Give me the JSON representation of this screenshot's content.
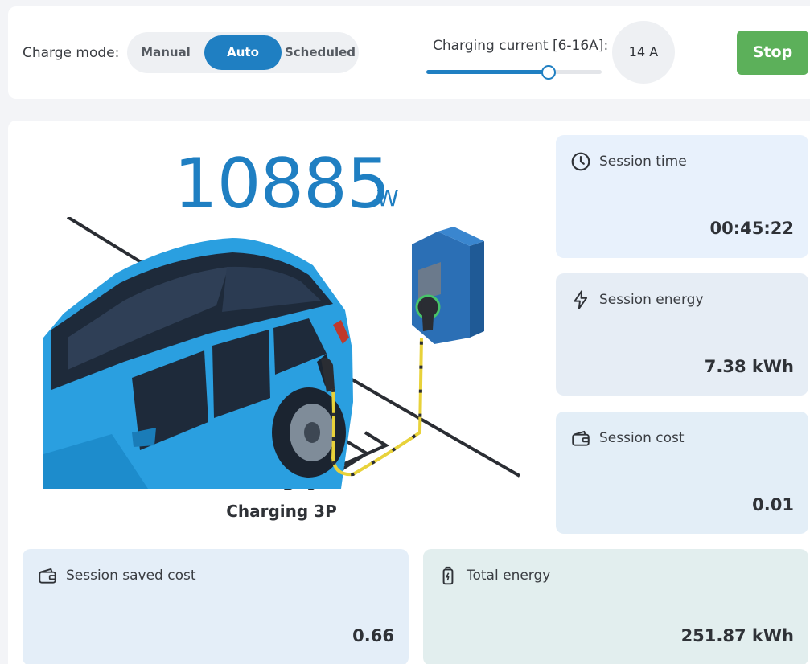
{
  "controls": {
    "charge_mode_label": "Charge mode:",
    "modes": [
      {
        "label": "Manual",
        "selected": false
      },
      {
        "label": "Auto",
        "selected": true
      },
      {
        "label": "Scheduled",
        "selected": false
      }
    ],
    "current_label": "Charging current [6-16A]:",
    "current_min": 6,
    "current_max": 16,
    "current_value": 14,
    "current_display": "14 A",
    "stop_label": "Stop"
  },
  "power": {
    "value": "10885",
    "unit": "W"
  },
  "status": "Charging 3P",
  "cards": {
    "session_time": {
      "label": "Session time",
      "value": "00:45:22"
    },
    "session_energy": {
      "label": "Session energy",
      "value": "7.38 kWh"
    },
    "session_cost": {
      "label": "Session cost",
      "value": "0.01"
    },
    "session_saved_cost": {
      "label": "Session saved cost",
      "value": "0.66"
    },
    "total_energy": {
      "label": "Total energy",
      "value": "251.87 kWh"
    }
  },
  "icons": {
    "session_time": "clock-icon",
    "session_energy": "lightning-icon",
    "session_cost": "wallet-icon",
    "session_saved_cost": "wallet-icon",
    "total_energy": "battery-icon"
  },
  "colors": {
    "accent": "#1f7fc2",
    "stop": "#5cb05a",
    "car": "#2a9fe0",
    "charger": "#2b6fb5"
  }
}
